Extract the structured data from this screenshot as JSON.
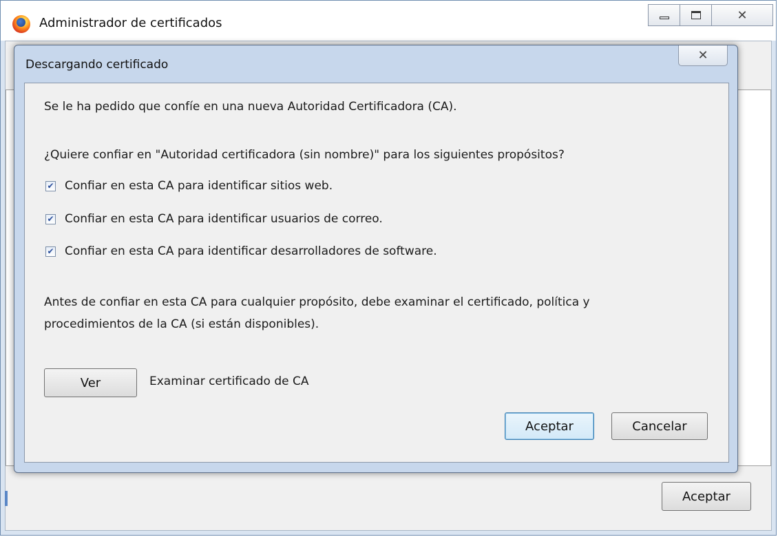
{
  "window": {
    "title": "Administrador de certificados",
    "ok_label": "Aceptar"
  },
  "dialog": {
    "title": "Descargando certificado",
    "intro": "Se le ha pedido que confíe en una nueva Autoridad Certificadora (CA).",
    "question": "¿Quiere confiar en \"Autoridad certificadora (sin nombre)\" para los siguientes propósitos?",
    "options": [
      {
        "label": "Confiar en esta CA para identificar sitios web.",
        "checked": true
      },
      {
        "label": "Confiar en esta CA para identificar usuarios de correo.",
        "checked": true
      },
      {
        "label": "Confiar en esta CA para identificar desarrolladores de software.",
        "checked": true
      }
    ],
    "warning_line1": "Antes de confiar en esta CA para cualquier propósito, debe examinar el certificado, política y",
    "warning_line2": "procedimientos de la CA (si están disponibles).",
    "view_button": "Ver",
    "view_description": "Examinar certificado de CA",
    "accept_button": "Aceptar",
    "cancel_button": "Cancelar"
  }
}
